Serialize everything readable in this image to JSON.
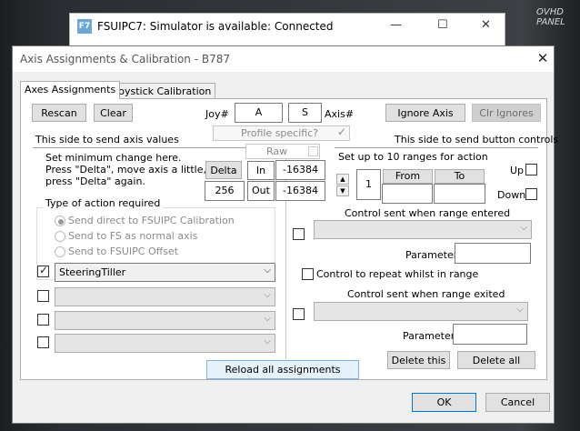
{
  "background": {
    "window_title": "FSUIPC7: Simulator is available: Connected",
    "logo_text": "F7",
    "overlay_text": "OVHD PANEL"
  },
  "dialog": {
    "title": "Axis Assignments & Calibration - B787",
    "close_glyph": "✕"
  },
  "tabs": [
    "Axes Assignments",
    "Joystick Calibration"
  ],
  "top": {
    "rescan": "Rescan",
    "clear": "Clear",
    "joy_label": "Joy#",
    "joy_value": "A",
    "axis_value": "S",
    "axis_label": "Axis#",
    "ignore_axis": "Ignore Axis",
    "clr_ignores": "Clr Ignores",
    "profile_specific": "Profile specific?"
  },
  "left": {
    "side_title": "This side to send axis values",
    "instructions": "Set minimum change  here.  Press \"Delta\", move axis a little,  press \"Delta\" again.",
    "delta_button": "Delta",
    "delta_value": "256",
    "raw_label": "Raw",
    "in_label": "In",
    "in_value": "-16384",
    "out_label": "Out",
    "out_value": "-16384",
    "type_group_title": "Type of action required",
    "radio_options": [
      {
        "label": "Send direct to FSUIPC Calibration",
        "selected": true
      },
      {
        "label": "Send to FS as normal axis",
        "selected": false
      },
      {
        "label": "Send to FSUIPC Offset",
        "selected": false
      }
    ],
    "assignments": [
      {
        "checked": true,
        "value": "SteeringTiller",
        "enabled": true
      },
      {
        "checked": false,
        "value": "",
        "enabled": false
      },
      {
        "checked": false,
        "value": "",
        "enabled": false
      },
      {
        "checked": false,
        "value": "",
        "enabled": false
      }
    ]
  },
  "right": {
    "side_title": "This side to send button controls",
    "ranges_title": "Set up to 10 ranges for action",
    "range_number": "1",
    "from_label": "From",
    "to_label": "To",
    "up_label": "Up",
    "down_label": "Down",
    "entered_title": "Control sent when range entered",
    "parameter_label": "Parameter",
    "repeat_label": "Control to repeat whilst in range",
    "exited_title": "Control sent when range exited",
    "parameter_label2": "Parameter",
    "delete_this": "Delete this",
    "delete_all": "Delete all"
  },
  "footer": {
    "reload": "Reload all assignments",
    "ok": "OK",
    "cancel": "Cancel"
  }
}
